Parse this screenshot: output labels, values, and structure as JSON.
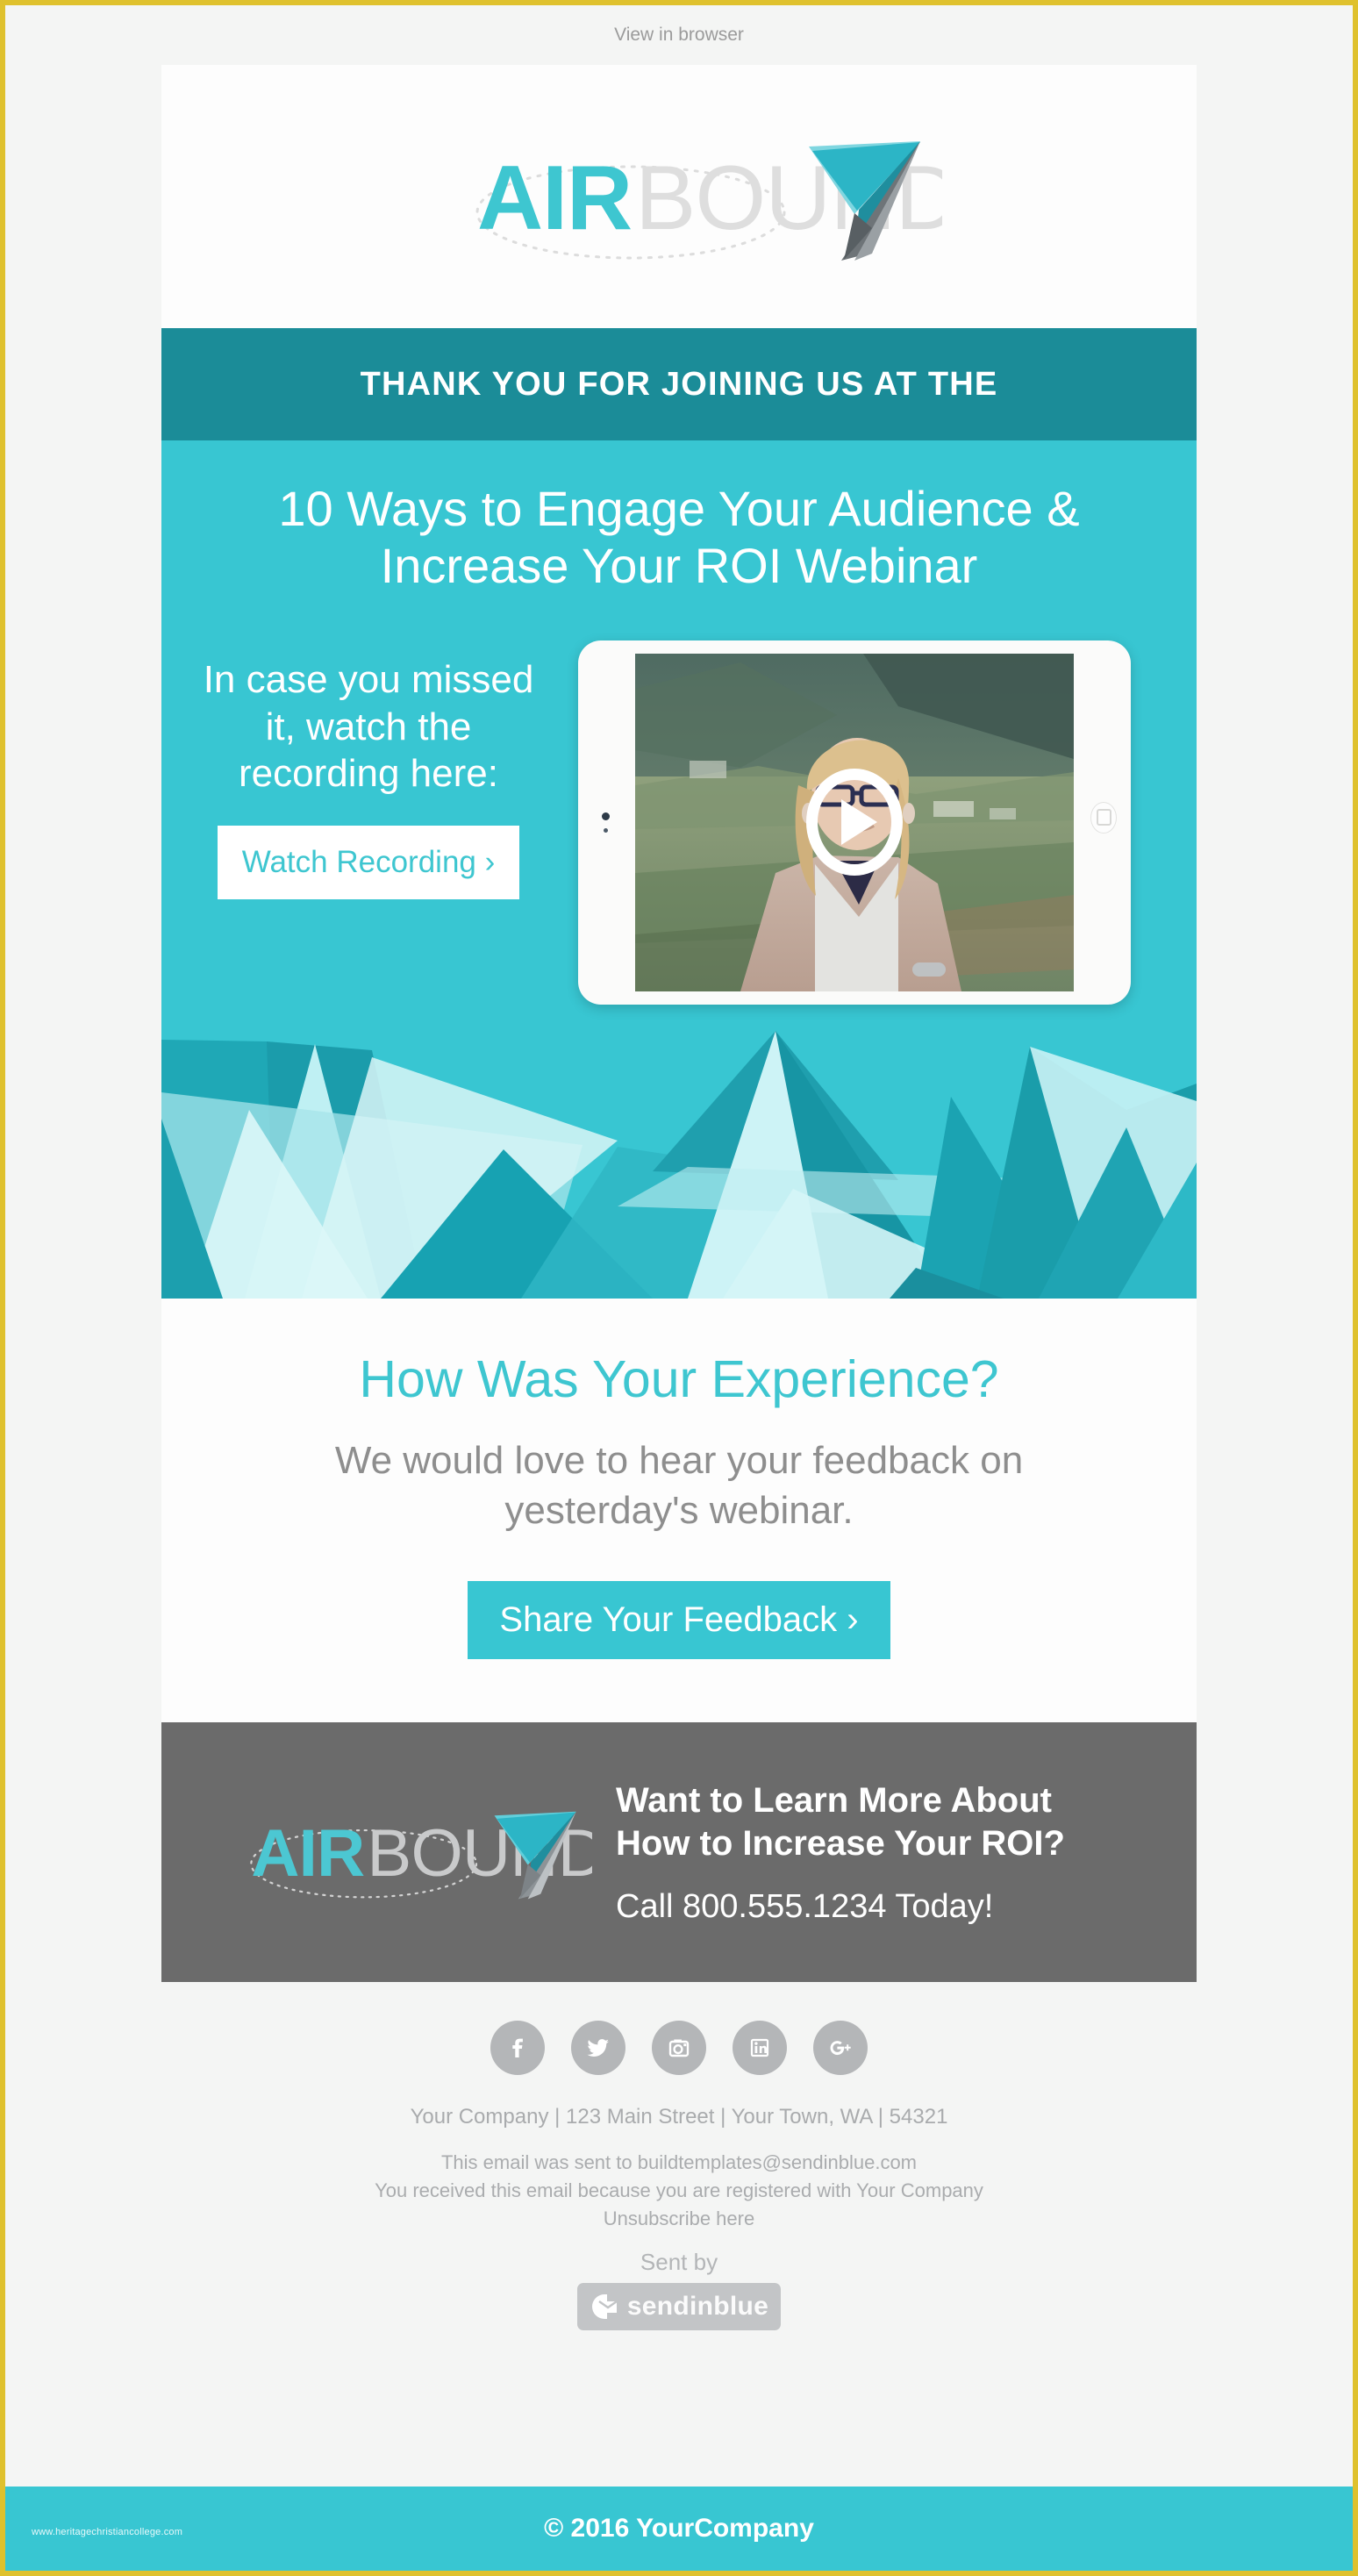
{
  "preheader": {
    "view_in_browser": "View in browser"
  },
  "brand": {
    "name_part1": "AIR",
    "name_part2": "BOUND",
    "accent_color": "#38c6d2",
    "dark_teal": "#1b8c98",
    "gray": "#6b6b6b"
  },
  "eyebrow": {
    "text": "THANK YOU FOR JOINING US AT THE"
  },
  "hero": {
    "headline": "10 Ways to Engage Your Audience & Increase Your ROI Webinar",
    "lead": "In case you missed it, watch the recording here:",
    "cta_label": "Watch Recording ›",
    "video": {
      "play_icon": "play-icon",
      "alt": "Webinar recording thumbnail: woman outdoors on hillside"
    }
  },
  "feedback": {
    "title": "How Was Your Experience?",
    "body": "We would love to hear your feedback on yesterday's webinar.",
    "cta_label": "Share Your Feedback ›"
  },
  "gray_cta": {
    "line1": "Want to Learn More About",
    "line2": "How to Increase Your ROI?",
    "phone": "Call 800.555.1234 Today!"
  },
  "social": [
    {
      "name": "facebook-icon",
      "label": "Facebook"
    },
    {
      "name": "twitter-icon",
      "label": "Twitter"
    },
    {
      "name": "instagram-icon",
      "label": "Instagram"
    },
    {
      "name": "linkedin-icon",
      "label": "LinkedIn"
    },
    {
      "name": "googleplus-icon",
      "label": "Google Plus"
    }
  ],
  "footer": {
    "address": "Your Company  |  123 Main Street  |  Your Town, WA  |  54321",
    "sent_to": "This email was sent to buildtemplates@sendinblue.com",
    "registered": "You received this email because you are registered with Your Company",
    "unsubscribe": "Unsubscribe here",
    "sent_by": "Sent by",
    "provider": "sendinblue"
  },
  "bottom": {
    "copyright": "© 2016 YourCompany",
    "watermark": "www.heritagechristiancollege.com"
  }
}
